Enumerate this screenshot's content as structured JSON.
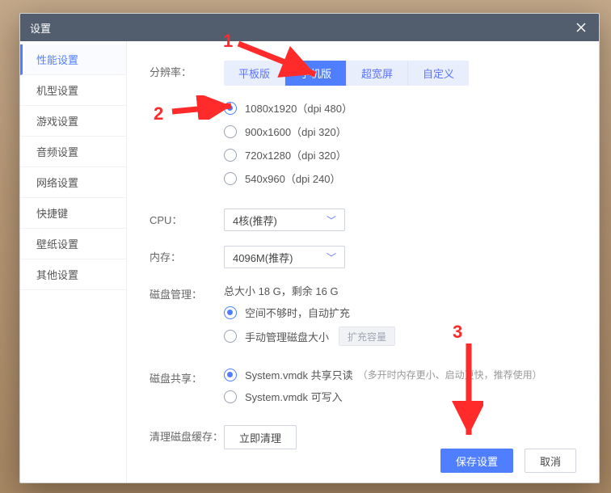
{
  "title": "设置",
  "sidebar": {
    "items": [
      {
        "label": "性能设置"
      },
      {
        "label": "机型设置"
      },
      {
        "label": "游戏设置"
      },
      {
        "label": "音频设置"
      },
      {
        "label": "网络设置"
      },
      {
        "label": "快捷键"
      },
      {
        "label": "壁纸设置"
      },
      {
        "label": "其他设置"
      }
    ],
    "active_index": 0
  },
  "resolution": {
    "label": "分辨率：",
    "tabs": [
      "平板版",
      "手机版",
      "超宽屏",
      "自定义"
    ],
    "active_tab": 1,
    "options": [
      "1080x1920（dpi 480）",
      "900x1600（dpi 320）",
      "720x1280（dpi 320）",
      "540x960（dpi 240）"
    ],
    "selected_option": 0
  },
  "cpu": {
    "label": "CPU：",
    "value": "4核(推荐)"
  },
  "memory": {
    "label": "内存：",
    "value": "4096M(推荐)"
  },
  "disk_manage": {
    "label": "磁盘管理：",
    "summary": "总大小 18 G，剩余 16 G",
    "opt_auto": "空间不够时，自动扩充",
    "opt_manual": "手动管理磁盘大小",
    "selected": 0,
    "expand_btn": "扩充容量"
  },
  "disk_share": {
    "label": "磁盘共享：",
    "opt_ro": "System.vmdk 共享只读",
    "opt_ro_hint": "（多开时内存更小、启动更快，推荐使用）",
    "opt_rw": "System.vmdk 可写入",
    "selected": 0
  },
  "clear_cache": {
    "label": "清理磁盘缓存：",
    "btn": "立即清理"
  },
  "footer": {
    "save": "保存设置",
    "cancel": "取消"
  },
  "annotations": {
    "n1": "1",
    "n2": "2",
    "n3": "3"
  }
}
